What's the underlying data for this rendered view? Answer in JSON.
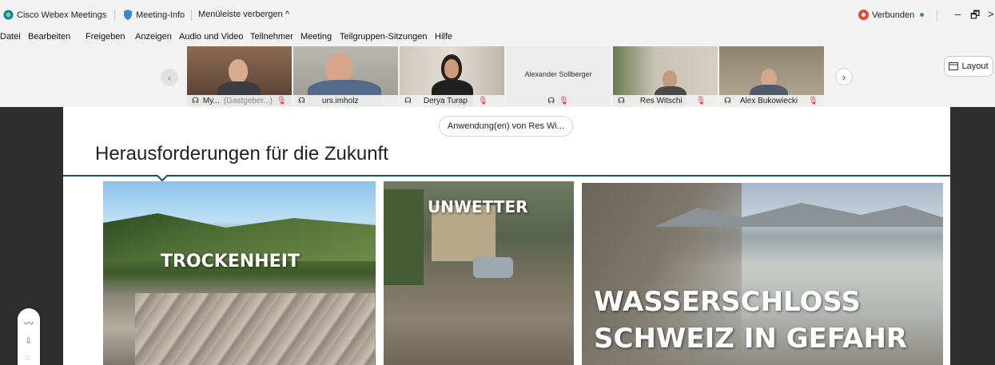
{
  "titlebar": {
    "app_name": "Cisco Webex Meetings",
    "meeting_info": "Meeting-Info",
    "hide_menu": "Menüleiste verbergen ^",
    "status": "Verbunden",
    "win_min": "–",
    "win_restore": "🗗",
    "win_more": ">"
  },
  "menu": {
    "items": [
      "Datei",
      "Bearbeiten",
      "Freigeben",
      "Anzeigen",
      "Audio und Video",
      "Teilnehmer",
      "Meeting",
      "Teilgruppen-Sitzungen",
      "Hilfe"
    ]
  },
  "participants": [
    {
      "name": "My...",
      "role": "(Gastgeber...)",
      "muted": true,
      "active": false
    },
    {
      "name": "urs.imholz",
      "role": "",
      "muted": false,
      "active": true
    },
    {
      "name": "Derya Turap",
      "role": "",
      "muted": true,
      "active": false
    },
    {
      "name": "",
      "center_name": "Alexander Sollberger",
      "role": "",
      "muted": true,
      "active": false
    },
    {
      "name": "Res Witschi",
      "role": "",
      "muted": true,
      "active": false
    },
    {
      "name": "Alex Bukowiecki",
      "role": "",
      "muted": true,
      "active": false
    }
  ],
  "strip": {
    "prev": "‹",
    "next": "›"
  },
  "layout_button": "Layout",
  "share_pill": "Anwendung(en) von Res Wi...",
  "slide": {
    "title": "Herausforderungen für die Zukunft",
    "panels": [
      "TROCKENHEIT",
      "UNWETTER",
      "WASSERSCHLOSS",
      "SCHWEIZ IN GEFAHR"
    ]
  },
  "colors": {
    "accent": "#27a3e0",
    "connected": "#2ea043",
    "record": "#e8472b",
    "muted": "#e0303a"
  }
}
